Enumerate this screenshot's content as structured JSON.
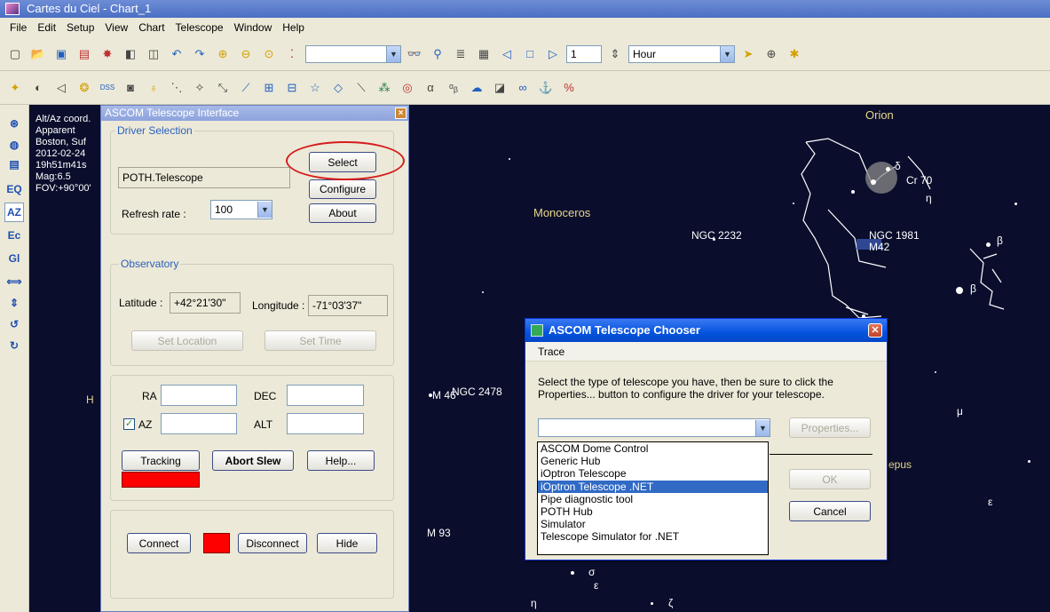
{
  "window": {
    "title": "Cartes du Ciel - Chart_1"
  },
  "menu": [
    "File",
    "Edit",
    "Setup",
    "View",
    "Chart",
    "Telescope",
    "Window",
    "Help"
  ],
  "toolbar": {
    "page_value": "1",
    "time_unit": "Hour",
    "dss_label": "DSS"
  },
  "sidebar": {
    "eq": "EQ",
    "az": "AZ",
    "ec": "Ec",
    "gl": "Gl"
  },
  "chart_info": {
    "line1": "Alt/Az coord.",
    "line2": "Apparent",
    "line3": "Boston, Suf",
    "line4": "2012-02-24",
    "line5": "19h51m41s",
    "line6": "Mag:6.5",
    "line7": "FOV:+90°00'"
  },
  "sky_labels": {
    "orion": "Orion",
    "monoceros": "Monoceros",
    "ngc2232": "NGC 2232",
    "ngc1981": "NGC 1981",
    "m42": "M42",
    "cr70": "Cr 70",
    "ngc2478": "NGC 2478",
    "m46": "M 46",
    "m93": "M 93",
    "lepus": "epus",
    "h": "H"
  },
  "telescope_interface": {
    "title": "ASCOM Telescope Interface",
    "driver_selection": "Driver Selection",
    "driver_value": "POTH.Telescope",
    "select_button": "Select",
    "configure_button": "Configure",
    "about_button": "About",
    "refresh_label": "Refresh rate :",
    "refresh_value": "100",
    "observatory": "Observatory",
    "latitude_label": "Latitude :",
    "latitude_value": "+42°21'30\"",
    "longitude_label": "Longitude :",
    "longitude_value": "-71°03'37\"",
    "set_location": "Set Location",
    "set_time": "Set Time",
    "ra_label": "RA",
    "dec_label": "DEC",
    "az_label": "AZ",
    "alt_label": "ALT",
    "tracking_button": "Tracking",
    "abort_button": "Abort Slew",
    "help_button": "Help...",
    "connect_button": "Connect",
    "disconnect_button": "Disconnect",
    "hide_button": "Hide"
  },
  "chooser": {
    "title": "ASCOM Telescope Chooser",
    "menu_trace": "Trace",
    "description": "Select the type of telescope you have, then be sure to click the Properties... button to configure the driver for your telescope.",
    "properties_button": "Properties...",
    "ok_button": "OK",
    "cancel_button": "Cancel",
    "options": [
      "ASCOM Dome Control",
      "Generic Hub",
      "iOptron Telescope",
      "iOptron Telescope .NET",
      "Pipe diagnostic tool",
      "POTH Hub",
      "Simulator",
      "Telescope Simulator for .NET"
    ],
    "selected_index": 3
  }
}
